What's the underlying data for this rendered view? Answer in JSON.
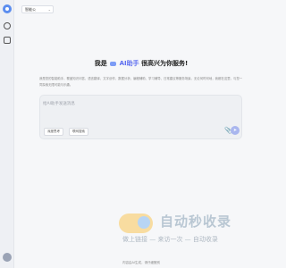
{
  "colors": {
    "accent": "#5b6cf0",
    "sidebar_bg": "#eef0f4",
    "page_bg": "#f6f7f9",
    "composer_bg": "#eef0f3",
    "send_button": "#a9b6ee"
  },
  "sidebar": {
    "icons": [
      "app-logo-icon",
      "chat-icon",
      "files-icon",
      "user-avatar-icon"
    ]
  },
  "model_selector": {
    "value": "智能公",
    "chevron": "⌄"
  },
  "hero": {
    "title_prefix": "我是",
    "brand": "AI助手",
    "title_suffix": "很高兴为你服务!",
    "description": "我是您的智能助手，覆盖知识问答、语言翻译、文字创作、数据分析、编程辅助、学习辅导、日常建议等服务场景。无论何时何地，我都在这里，与您一同探索无限可能与乐趣。"
  },
  "composer": {
    "placeholder": "给AI助手发送消息",
    "chip_deep_label": "深度思考",
    "chip_web_label": "联网搜索",
    "attach_icon": "📎",
    "send_icon": "➤"
  },
  "watermark": {
    "title": "自动秒收录",
    "subtitle": "做上链接 — 来访一次 — 自动收录"
  },
  "footer": {
    "text": "内容由AI生成，请仔细甄别"
  }
}
